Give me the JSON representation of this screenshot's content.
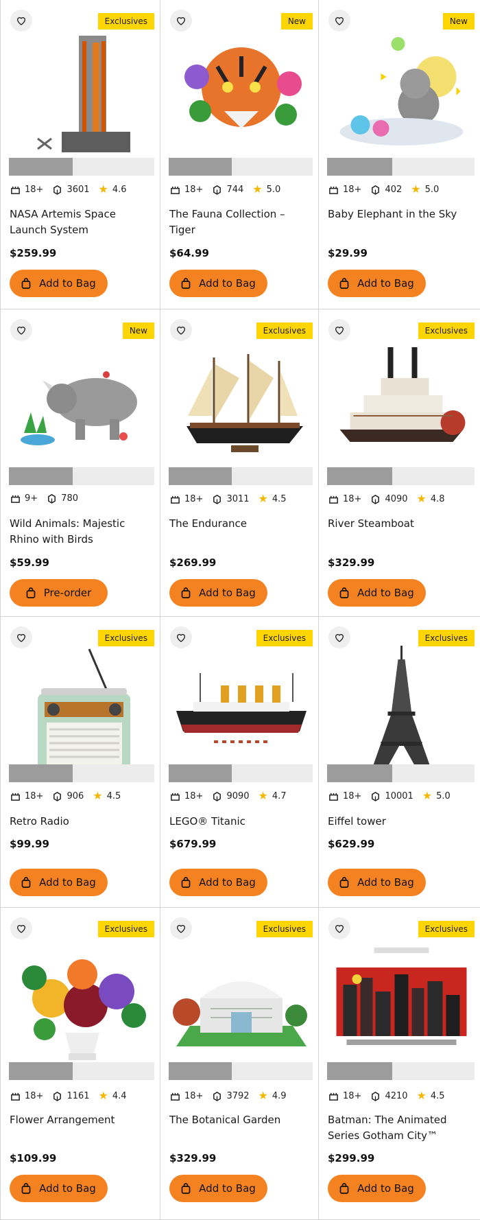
{
  "products": [
    {
      "name": "NASA Artemis Space Launch System",
      "badge": "Exclusives",
      "age": "18+",
      "pieces": "3601",
      "rating": "4.6",
      "price": "$259.99",
      "cta": "Add to Bag",
      "image": "rocket-launch-tower"
    },
    {
      "name": "The Fauna Collection – Tiger",
      "badge": "New",
      "age": "18+",
      "pieces": "744",
      "rating": "5.0",
      "price": "$64.99",
      "cta": "Add to Bag",
      "image": "tiger-head-flowers"
    },
    {
      "name": "Baby Elephant in the Sky",
      "badge": "New",
      "age": "18+",
      "pieces": "402",
      "rating": "5.0",
      "price": "$29.99",
      "cta": "Add to Bag",
      "image": "elephant-on-cloud"
    },
    {
      "name": "Wild Animals: Majestic Rhino with Birds",
      "badge": "New",
      "age": "9+",
      "pieces": "780",
      "rating": "",
      "price": "$59.99",
      "cta": "Pre-order",
      "image": "rhino"
    },
    {
      "name": "The Endurance",
      "badge": "Exclusives",
      "age": "18+",
      "pieces": "3011",
      "rating": "4.5",
      "price": "$269.99",
      "cta": "Add to Bag",
      "image": "sailing-ship"
    },
    {
      "name": "River Steamboat",
      "badge": "Exclusives",
      "age": "18+",
      "pieces": "4090",
      "rating": "4.8",
      "price": "$329.99",
      "cta": "Add to Bag",
      "image": "steamboat"
    },
    {
      "name": "Retro Radio",
      "badge": "Exclusives",
      "age": "18+",
      "pieces": "906",
      "rating": "4.5",
      "price": "$99.99",
      "cta": "Add to Bag",
      "image": "retro-radio"
    },
    {
      "name": "LEGO® Titanic",
      "badge": "Exclusives",
      "age": "18+",
      "pieces": "9090",
      "rating": "4.7",
      "price": "$679.99",
      "cta": "Add to Bag",
      "image": "titanic-ship"
    },
    {
      "name": "Eiffel tower",
      "badge": "Exclusives",
      "age": "18+",
      "pieces": "10001",
      "rating": "5.0",
      "price": "$629.99",
      "cta": "Add to Bag",
      "image": "eiffel-tower"
    },
    {
      "name": "Flower Arrangement",
      "badge": "Exclusives",
      "age": "18+",
      "pieces": "1161",
      "rating": "4.4",
      "price": "$109.99",
      "cta": "Add to Bag",
      "image": "flower-vase"
    },
    {
      "name": "The Botanical Garden",
      "badge": "Exclusives",
      "age": "18+",
      "pieces": "3792",
      "rating": "4.9",
      "price": "$329.99",
      "cta": "Add to Bag",
      "image": "botanical-garden"
    },
    {
      "name": "Batman: The Animated Series Gotham City™",
      "badge": "Exclusives",
      "age": "18+",
      "pieces": "4210",
      "rating": "4.5",
      "price": "$299.99",
      "cta": "Add to Bag",
      "image": "gotham-city-batman"
    }
  ],
  "progress": 0.44,
  "colors": {
    "badge": "#ffd500",
    "button": "#f58220",
    "star": "#f5b800"
  },
  "icons": {
    "wishlist": "heart-icon",
    "age": "age-icon",
    "pieces": "pieces-icon",
    "rating": "star-icon",
    "cart": "bag-icon"
  }
}
